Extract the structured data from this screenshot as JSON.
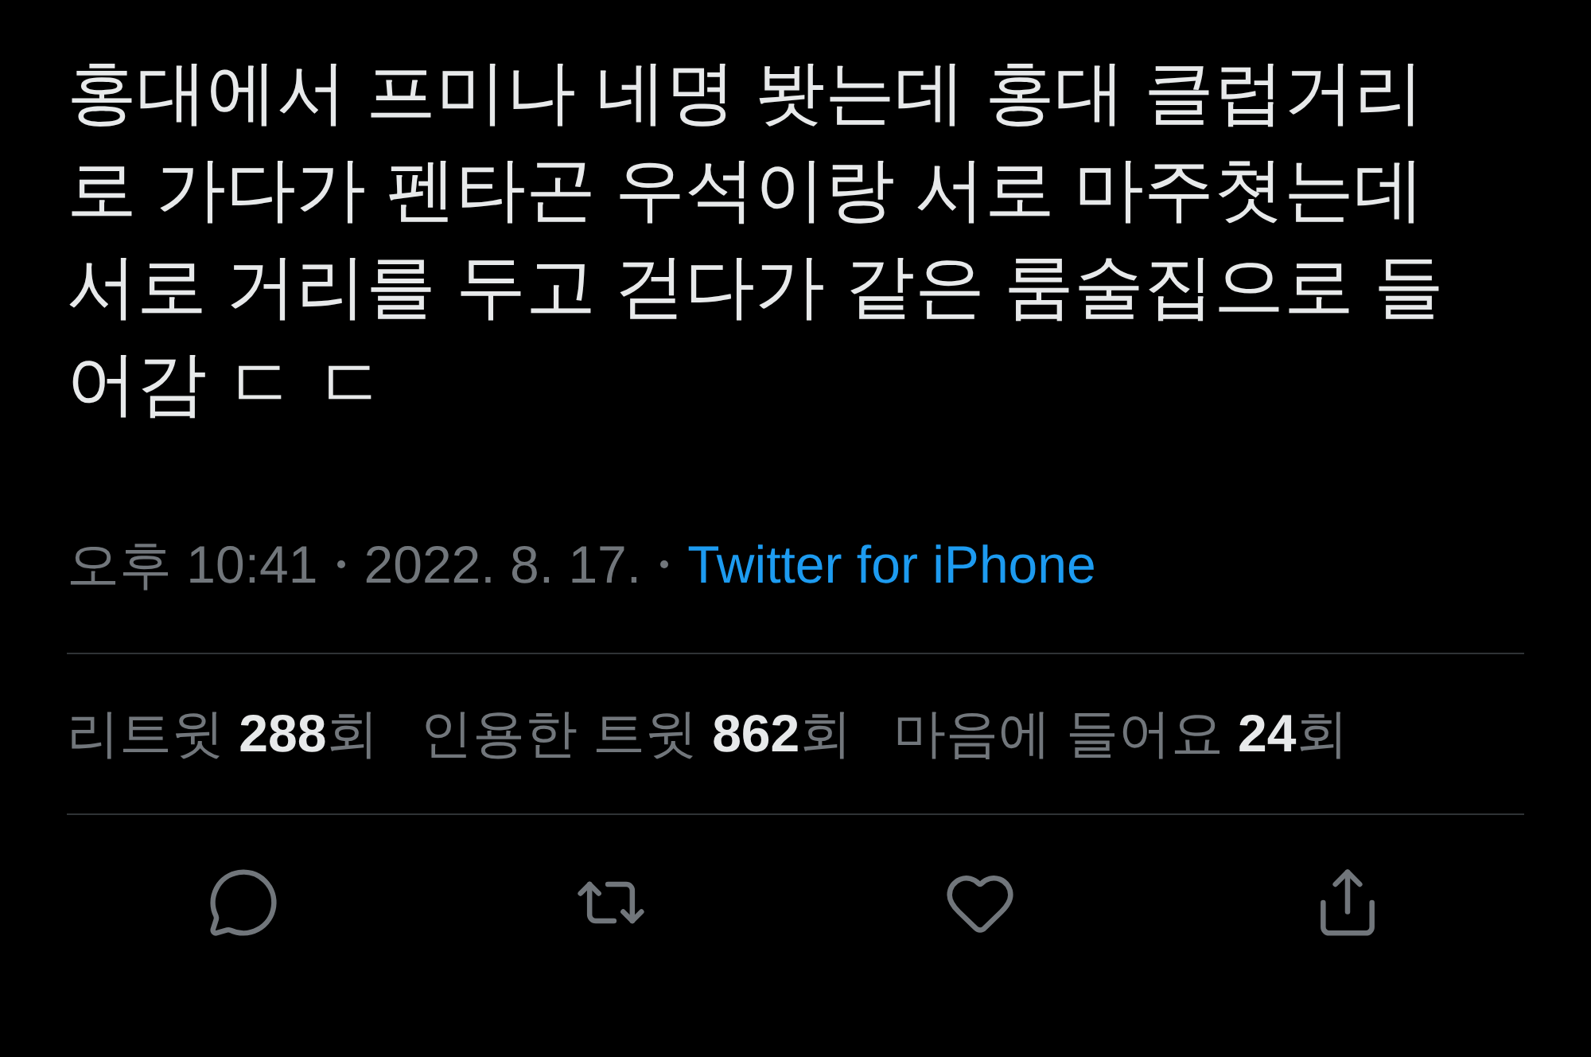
{
  "tweet": {
    "text": "홍대에서 프미나 네명 봣는데 홍대 클럽거리로 가다가 펜타곤 우석이랑 서로 마주쳣는데 서로 거리를 두고 걷다가 같은 룸술집으로 들어감 ㄷ ㄷ",
    "time": "오후 10:41",
    "date": "2022. 8. 17.",
    "source": "Twitter for iPhone"
  },
  "stats": [
    {
      "label": "리트윗",
      "count": "288",
      "unit": "회"
    },
    {
      "label": "인용한 트윗",
      "count": "862",
      "unit": "회"
    },
    {
      "label": "마음에 들어요",
      "count": "24",
      "unit": "회"
    }
  ],
  "actions": [
    {
      "kind": "reply"
    },
    {
      "kind": "retweet"
    },
    {
      "kind": "like"
    },
    {
      "kind": "share"
    }
  ]
}
